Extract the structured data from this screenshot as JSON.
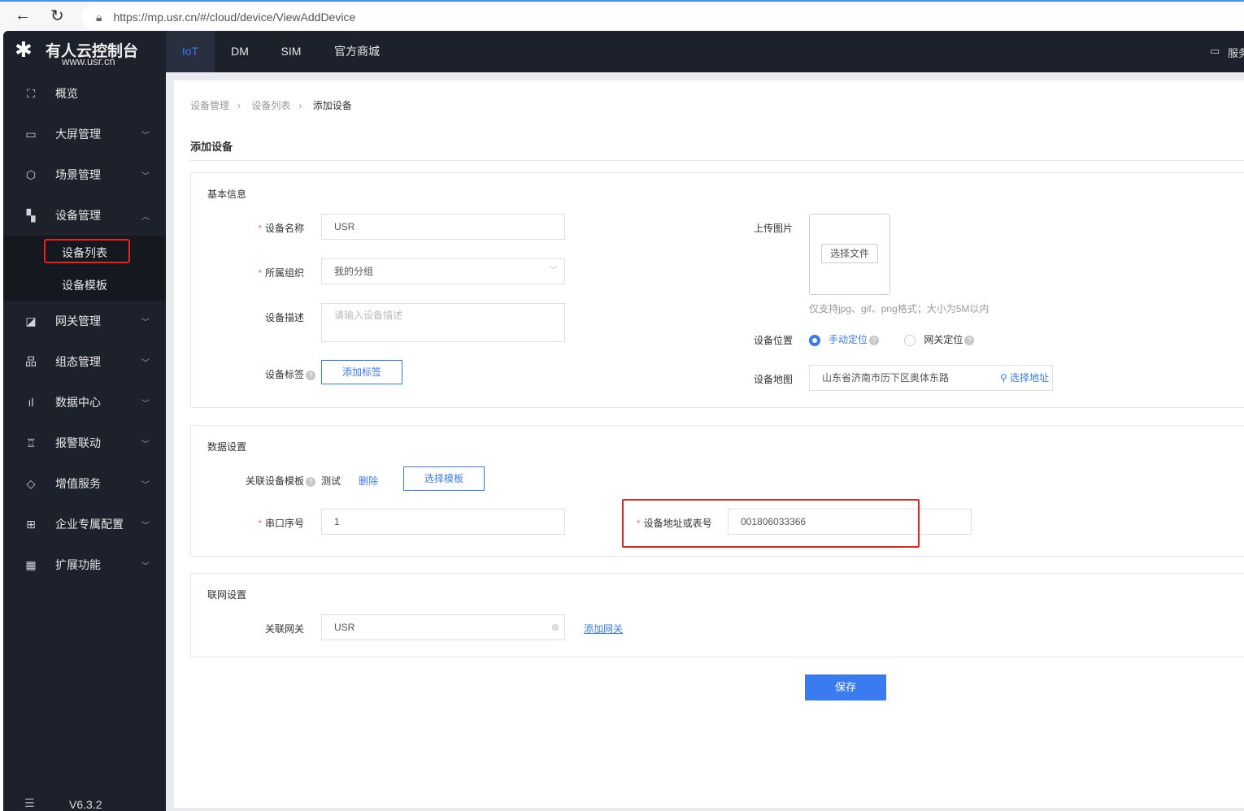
{
  "browser": {
    "url": "https://mp.usr.cn/#/cloud/device/ViewAddDevice"
  },
  "sidebar": {
    "logo_title": "有人云控制台",
    "logo_url": "www.usr.cn",
    "items": [
      {
        "label": "概览",
        "icon": "scan-icon"
      },
      {
        "label": "大屏管理",
        "icon": "monitor-icon"
      },
      {
        "label": "场景管理",
        "icon": "cube-icon"
      },
      {
        "label": "设备管理",
        "icon": "device-icon"
      },
      {
        "label": "网关管理",
        "icon": "chart-icon"
      },
      {
        "label": "组态管理",
        "icon": "topology-icon"
      },
      {
        "label": "数据中心",
        "icon": "bar-chart-icon"
      },
      {
        "label": "报警联动",
        "icon": "alarm-icon"
      },
      {
        "label": "增值服务",
        "icon": "diamond-icon"
      },
      {
        "label": "企业专属配置",
        "icon": "enterprise-icon"
      },
      {
        "label": "扩展功能",
        "icon": "grid-icon"
      }
    ],
    "sub_items": [
      {
        "label": "设备列表",
        "active": true
      },
      {
        "label": "设备模板"
      }
    ],
    "version": "V6.3.2"
  },
  "topnav": {
    "tabs": [
      {
        "label": "IoT",
        "active": true
      },
      {
        "label": "DM"
      },
      {
        "label": "SIM"
      },
      {
        "label": "官方商城"
      }
    ],
    "service": "服务"
  },
  "breadcrumb": [
    "设备管理",
    "设备列表",
    "添加设备"
  ],
  "page_title": "添加设备",
  "basic": {
    "title": "基本信息",
    "name_label": "设备名称",
    "name_value": "USR",
    "org_label": "所属组织",
    "org_value": "我的分组",
    "desc_label": "设备描述",
    "desc_placeholder": "请输入设备描述",
    "tag_label": "设备标签",
    "tag_button": "添加标签",
    "upload_label": "上传图片",
    "upload_button": "选择文件",
    "upload_hint": "仅支持jpg、gif、png格式；大小为5M以内",
    "location_label": "设备位置",
    "loc_manual": "手动定位",
    "loc_gateway": "网关定位",
    "map_label": "设备地图",
    "map_value": "山东省济南市历下区奥体东路",
    "map_button": "选择地址"
  },
  "data_settings": {
    "title": "数据设置",
    "template_label": "关联设备模板",
    "template_value": "测试",
    "delete": "删除",
    "select_template": "选择模板",
    "serial_label": "串口序号",
    "serial_value": "1",
    "address_label": "设备地址或表号",
    "address_value": "001806033366"
  },
  "network": {
    "title": "联网设置",
    "gateway_label": "关联网关",
    "gateway_value": "USR",
    "add_gateway": "添加网关"
  },
  "save": "保存",
  "colors": {
    "accent": "#3a7bef",
    "sidebar": "#1d212b",
    "highlight": "#e6261e"
  }
}
